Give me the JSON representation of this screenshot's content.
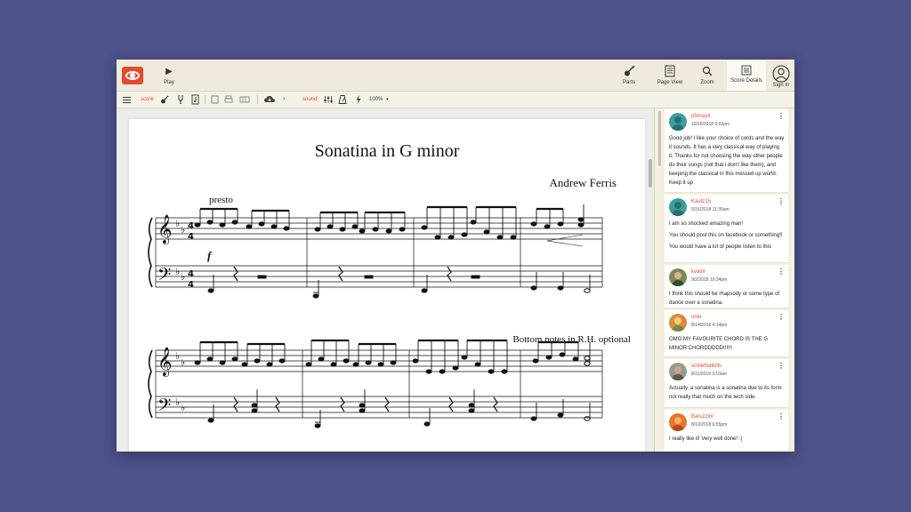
{
  "toolbar": {
    "play_label": "Play",
    "parts_label": "Parts",
    "page_view_label": "Page View",
    "zoom_label": "Zoom",
    "score_details_label": "Score Details",
    "sign_in_label": "Sign In"
  },
  "toolbar2": {
    "score_label": "score",
    "sound_label": "sound",
    "zoom_value": "100%"
  },
  "score": {
    "title": "Sonatina in G minor",
    "composer": "Andrew Ferris",
    "tempo": "presto",
    "dynamic": "f",
    "note": "Bottom notes in R.H. optional"
  },
  "comments": [
    {
      "user": "p5may4",
      "date": "10/16/2018 9:02pm",
      "text": [
        "Good job! I like your choice of cords and the way it sounds. It has a very classical way of playing it. Thanks for not choosing the way other people do their songs (not that i don't like them), and keeping the classical in this messed up world. Keep it up"
      ]
    },
    {
      "user": "Kautz15",
      "date": "9/16/2018 11:30am",
      "text": [
        "I am so shocked amazing man!",
        "You should post this on facebook or something!!",
        "You would have a lot of people listen to this"
      ]
    },
    {
      "user": "kvalor",
      "date": "9/2/2018 10:34pm",
      "text": [
        "I think this should be rhapsody or some type of dance over a sonatina."
      ]
    },
    {
      "user": "onio",
      "date": "8/14/2018 4:14pm",
      "text": [
        "OMG.MY FAVOURITE CHORD IS THE G MINOR CHORDDDDD!!!!!!"
      ]
    },
    {
      "user": "smilethatkills",
      "date": "8/11/2018 3:10am",
      "text": [
        "Actually, a sonatina is a sonatina due to its form not really that much on the tech side."
      ]
    },
    {
      "user": "Baruzzini",
      "date": "8/10/2018 6:55pm",
      "text": [
        "I really like it! Very well done! :)"
      ]
    }
  ],
  "colors": {
    "accent": "#e44a2d",
    "toolbar_bg": "#efeadb",
    "background": "#4c528a"
  },
  "icons": {
    "logo": "eye-logo-icon",
    "play": "play-icon",
    "parts": "guitar-icon",
    "page_view": "page-icon",
    "zoom": "magnifier-icon",
    "score_details": "list-icon",
    "sign_in": "user-circle-icon"
  }
}
